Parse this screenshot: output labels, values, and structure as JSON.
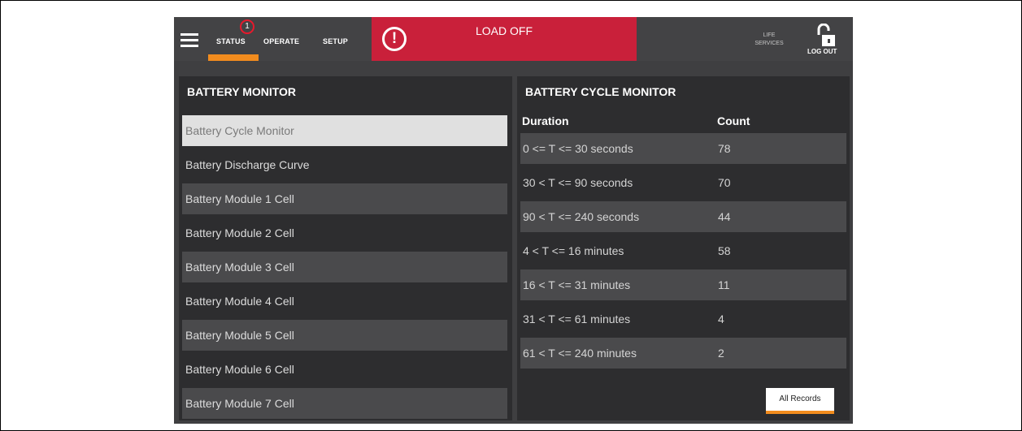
{
  "header": {
    "nav": [
      {
        "label": "STATUS",
        "active": true
      },
      {
        "label": "OPERATE",
        "active": false
      },
      {
        "label": "SETUP",
        "active": false
      }
    ],
    "status_badge": "1",
    "alarm_text": "LOAD OFF",
    "alarm_icon": "exclamation-circle-icon",
    "life_services_label": "LIFE SERVICES",
    "logout_label": "LOG OUT",
    "lock_icon": "unlocked-padlock-icon",
    "colors": {
      "accent": "#f28c1e",
      "alarm": "#c9203a",
      "background": "#3f3f41"
    }
  },
  "battery_monitor": {
    "title": "BATTERY MONITOR",
    "items": [
      "Battery Cycle Monitor",
      "Battery Discharge Curve",
      "Battery Module 1 Cell",
      "Battery Module 2 Cell",
      "Battery Module 3 Cell",
      "Battery Module 4 Cell",
      "Battery Module 5 Cell",
      "Battery Module 6 Cell",
      "Battery Module 7 Cell"
    ],
    "selected_index": 0
  },
  "cycle_monitor": {
    "title": "BATTERY CYCLE MONITOR",
    "columns": [
      "Duration",
      "Count"
    ],
    "rows": [
      {
        "duration": "0 <= T <= 30 seconds",
        "count": "78"
      },
      {
        "duration": "30 < T <= 90 seconds",
        "count": "70"
      },
      {
        "duration": "90 < T <= 240 seconds",
        "count": "44"
      },
      {
        "duration": "4 < T <= 16 minutes",
        "count": "58"
      },
      {
        "duration": "16 < T <= 31 minutes",
        "count": "11"
      },
      {
        "duration": "31 < T <= 61 minutes",
        "count": "4"
      },
      {
        "duration": "61 < T <= 240 minutes",
        "count": "2"
      }
    ],
    "all_records_label": "All Records"
  }
}
